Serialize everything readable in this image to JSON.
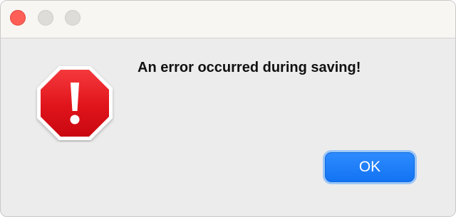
{
  "window": {
    "controls": {
      "close_icon": "close-dot",
      "minimize_icon": "minimize-dot",
      "zoom_icon": "zoom-dot",
      "close_color": "#ff5f57",
      "inactive_color": "#dedcd8"
    }
  },
  "alert": {
    "icon": "stop-sign-exclamation-icon",
    "icon_color": "#e0141b",
    "message": "An error occurred during saving!",
    "ok_label": "OK",
    "button_color": "#1a7bf5"
  }
}
